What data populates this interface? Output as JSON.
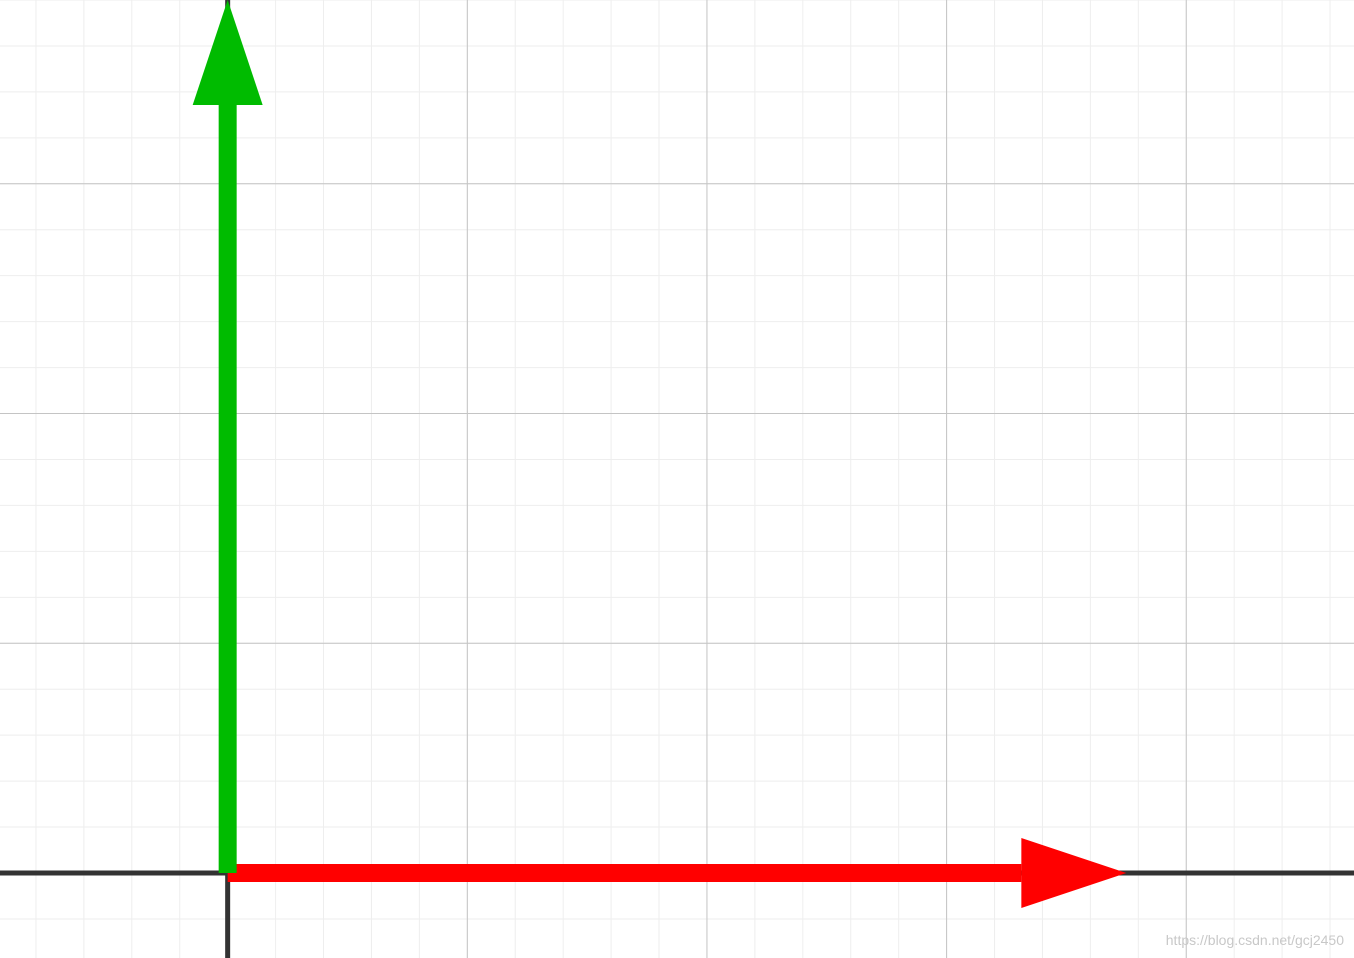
{
  "diagram": {
    "type": "vector-plot",
    "grid": true,
    "minor_grid": true,
    "x_range": [
      -0.95,
      4.7
    ],
    "y_range": [
      -0.37,
      3.8
    ],
    "major_step": 1,
    "minor_per_major": 5,
    "vectors": [
      {
        "name": "x-vector",
        "from": [
          0,
          0
        ],
        "to": [
          3.75,
          0
        ],
        "color": "#ff0000"
      },
      {
        "name": "y-vector",
        "from": [
          0,
          0
        ],
        "to": [
          0,
          3.8
        ],
        "color": "#00bb00"
      }
    ],
    "colors": {
      "axis": "#333333",
      "major_grid": "#c4c4c4",
      "minor_grid": "#eeeeee",
      "background": "#ffffff"
    }
  },
  "watermark": "https://blog.csdn.net/gcj2450"
}
